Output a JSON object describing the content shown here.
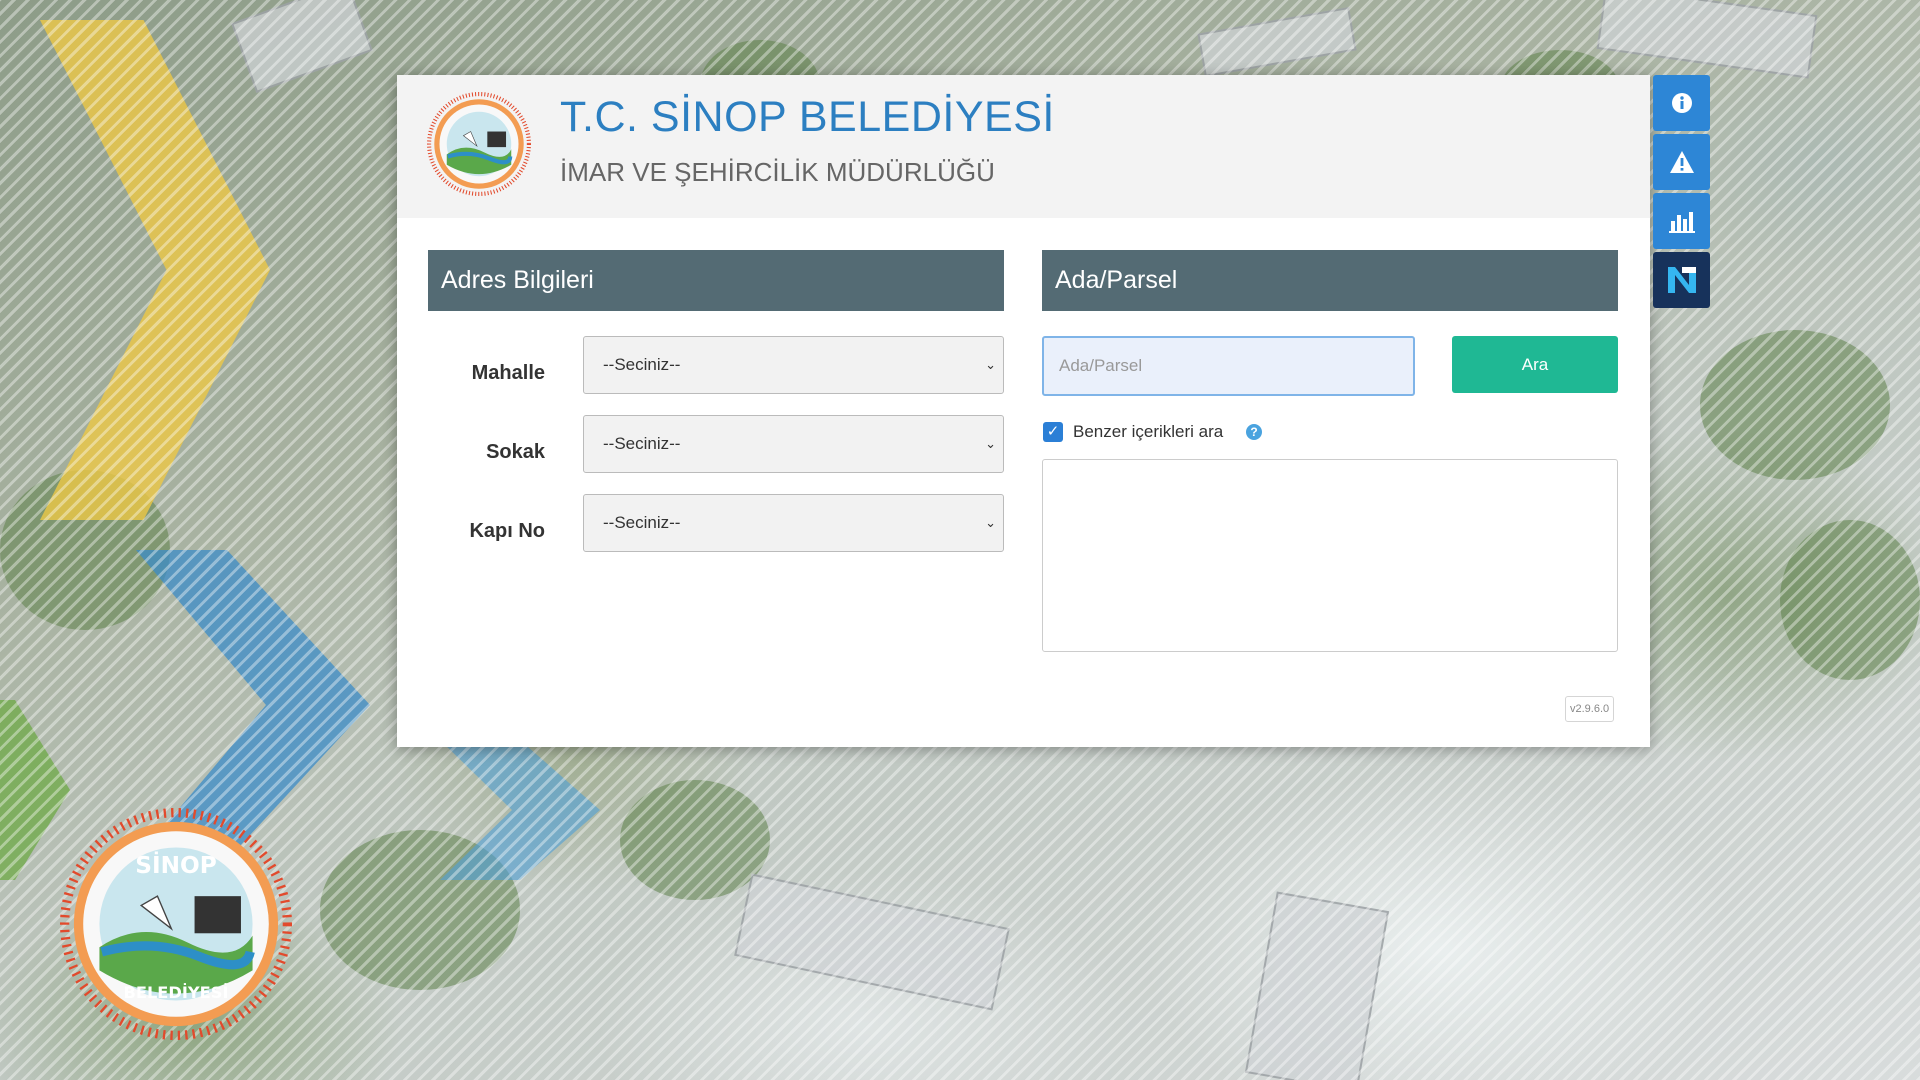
{
  "header": {
    "title": "T.C. SİNOP BELEDİYESİ",
    "subtitle": "İMAR VE ŞEHİRCİLİK MÜDÜRLÜĞÜ",
    "logo_text_top": "SİNOP",
    "logo_text_bottom": "BELEDİYESİ"
  },
  "address": {
    "heading": "Adres Bilgileri",
    "fields": [
      {
        "label": "Mahalle",
        "value": "--Seciniz--"
      },
      {
        "label": "Sokak",
        "value": "--Seciniz--"
      },
      {
        "label": "Kapı No",
        "value": "--Seciniz--"
      }
    ]
  },
  "parcel": {
    "heading": "Ada/Parsel",
    "input_placeholder": "Ada/Parsel",
    "search_label": "Ara",
    "similar_label": "Benzer içerikleri ara",
    "similar_checked": true
  },
  "version": "v2.9.6.0",
  "side_buttons": [
    {
      "icon": "info-icon"
    },
    {
      "icon": "warning-icon"
    },
    {
      "icon": "bar-chart-icon"
    },
    {
      "icon": "netcad-logo-icon"
    }
  ],
  "colors": {
    "title": "#2c7fc1",
    "section_header": "#546b74",
    "search_button": "#1fb894",
    "side_button": "#2d86d6",
    "side_button_dark": "#17325b"
  }
}
